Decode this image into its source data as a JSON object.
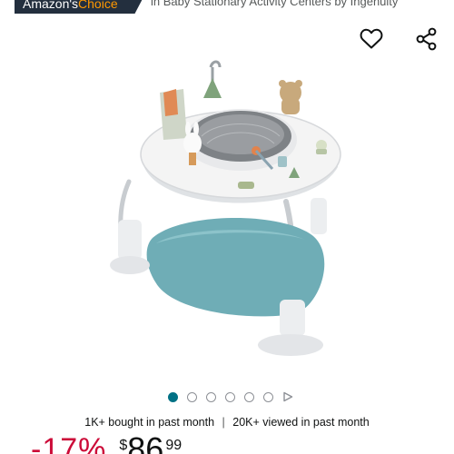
{
  "badge": {
    "label_part1": "Amazon's ",
    "label_part2": "Choice",
    "context": "in Baby Stationary Activity Centers by Ingenuity",
    "bg_color": "#232f3e",
    "accent_color": "#ff9900"
  },
  "actions": {
    "favorite_icon": "heart-outline-icon",
    "share_icon": "share-icon"
  },
  "carousel": {
    "total_dots": 6,
    "active_index": 0,
    "video_indicator": "play-icon",
    "active_color": "#007185"
  },
  "social_proof": {
    "bought": "1K+ bought in past month",
    "separator": "|",
    "viewed": "20K+ viewed in past month"
  },
  "price": {
    "discount": "-17%",
    "currency": "$",
    "whole": "86",
    "fraction": "99",
    "discount_color": "#cc0c39"
  }
}
